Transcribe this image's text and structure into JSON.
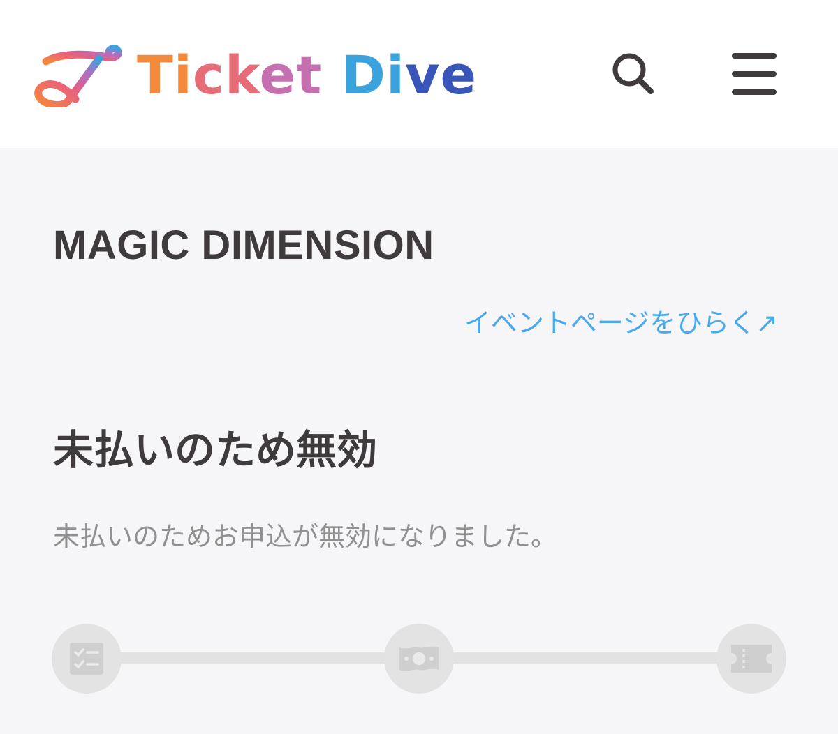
{
  "header": {
    "logo_text": "Ticket Dive",
    "logo_alt": "Ticket Dive",
    "search_label": "search",
    "menu_label": "menu"
  },
  "event": {
    "title": "MAGIC DIMENSION",
    "link_label": "イベントページをひらく↗"
  },
  "status": {
    "title": "未払いのため無効",
    "description": "未払いのためお申込が無効になりました。"
  },
  "stepper": {
    "steps": [
      {
        "icon": "checklist-icon",
        "state": "inactive"
      },
      {
        "icon": "payment-icon",
        "state": "inactive"
      },
      {
        "icon": "ticket-icon",
        "state": "inactive"
      }
    ]
  },
  "colors": {
    "background": "#f6f6f8",
    "header_bg": "#ffffff",
    "text": "#3f3b3c",
    "link": "#4aa8ec",
    "muted": "#909090",
    "step_inactive": "#e3e3e3",
    "step_icon": "#cfcfcf"
  }
}
